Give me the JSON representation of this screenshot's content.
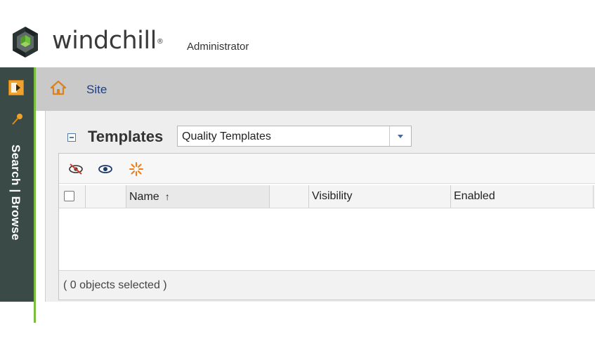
{
  "header": {
    "brand": "windchill",
    "brand_mark": "®",
    "role": "Administrator",
    "logo_icon": "windchill-logo-icon"
  },
  "rail": {
    "toggle_icon": "expand-panel-icon",
    "pin_icon": "pin-icon",
    "label": "Search | Browse",
    "accent": "#7bbd3f",
    "background": "#3a4a47"
  },
  "breadcrumb": {
    "home_icon": "home-icon",
    "site": "Site"
  },
  "templates": {
    "title": "Templates",
    "filter": {
      "selected": "Quality Templates"
    },
    "toolbar": {
      "icons": [
        "hide-icon",
        "show-icon",
        "new-template-icon"
      ]
    },
    "columns": [
      "Name",
      "Visibility",
      "Enabled"
    ],
    "sort_indicator": "↑",
    "status": "( 0 objects selected )"
  }
}
